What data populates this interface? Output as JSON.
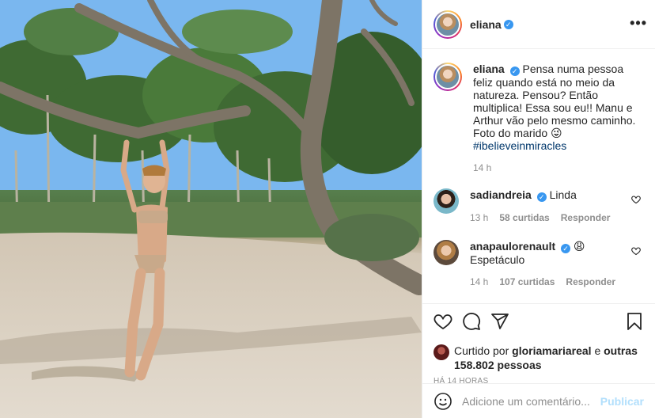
{
  "post": {
    "author": "eliana",
    "verified": true,
    "more_icon": "more-horizontal-icon",
    "caption": {
      "text": "Pensa numa pessoa feliz quando está no meio da natureza. Pensou? Então multiplica! Essa sou eu!! Manu e Arthur vão pelo mesmo caminho.\nFoto do marido 😜",
      "hashtag": "#ibelieveinmiracles",
      "time": "14 h"
    },
    "comments": [
      {
        "username": "sadiandreia",
        "verified": true,
        "text": "Linda",
        "time": "13 h",
        "likes": "58 curtidas",
        "reply": "Responder"
      },
      {
        "username": "anapaulorenault",
        "verified": true,
        "emoji": "😩",
        "text": "Espetáculo",
        "time": "14 h",
        "likes": "107 curtidas",
        "reply": "Responder"
      }
    ],
    "actions": {
      "like_icon": "heart-icon",
      "comment_icon": "comment-icon",
      "share_icon": "send-icon",
      "save_icon": "bookmark-icon"
    },
    "liked_by": {
      "prefix": "Curtido por",
      "user": "gloriamariareal",
      "middle": "e",
      "others": "outras 158.802 pessoas"
    },
    "posted_ago": "HÁ 14 HORAS",
    "comment_input": {
      "placeholder": "Adicione um comentário...",
      "publish": "Publicar"
    }
  },
  "colors": {
    "accent": "#3897f0",
    "publish_disabled": "#b2dffc",
    "muted": "#8e8e8e",
    "hashtag": "#00376b"
  }
}
